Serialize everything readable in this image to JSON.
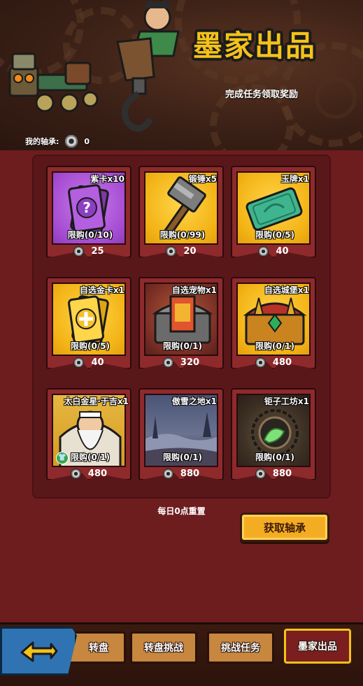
{
  "header": {
    "title": "墨家出品",
    "subtitle": "完成任务领取奖励",
    "bearing_label": "我的轴承:",
    "bearing_count": "0"
  },
  "shop": {
    "items": [
      {
        "name": "紫卡x10",
        "limit": "限购(0/10)",
        "price": "25",
        "icon": "purple-card-icon"
      },
      {
        "name": "锻锤x5",
        "limit": "限购(0/99)",
        "price": "20",
        "icon": "hammer-icon"
      },
      {
        "name": "玉牌x1",
        "limit": "限购(0/5)",
        "price": "40",
        "icon": "jade-tablet-icon"
      },
      {
        "name": "自选金卡x1",
        "limit": "限购(0/5)",
        "price": "40",
        "icon": "gold-card-icon"
      },
      {
        "name": "自选宠物x1",
        "limit": "限购(0/1)",
        "price": "320",
        "icon": "pet-chest-icon"
      },
      {
        "name": "自选城堡x1",
        "limit": "限购(0/1)",
        "price": "480",
        "icon": "castle-chest-icon"
      },
      {
        "name": "太白金星·于吉x1",
        "limit": "限购(0/1)",
        "price": "480",
        "icon": "hero-portrait-icon"
      },
      {
        "name": "傲雪之地x1",
        "limit": "限购(0/1)",
        "price": "880",
        "icon": "snow-land-icon"
      },
      {
        "name": "钜子工坊x1",
        "limit": "限购(0/1)",
        "price": "880",
        "icon": "workshop-icon"
      }
    ]
  },
  "footer": {
    "reset_note": "每日0点重置",
    "get_bearing_label": "获取轴承"
  },
  "tabs": [
    {
      "label": "转盘"
    },
    {
      "label": "转盘挑战"
    },
    {
      "label": "挑战任务"
    },
    {
      "label": "墨家出品"
    }
  ],
  "colors": {
    "background": "#6e1d1f",
    "accent": "#f4c21a",
    "card": "#8e2a2c"
  }
}
